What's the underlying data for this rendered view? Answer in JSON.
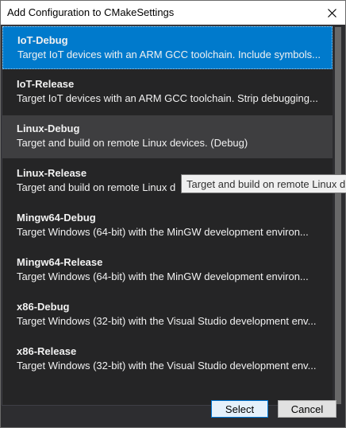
{
  "window": {
    "title": "Add Configuration to CMakeSettings"
  },
  "configurations": [
    {
      "name": "IoT-Debug",
      "description": "Target IoT devices with an ARM GCC toolchain. Include symbols..."
    },
    {
      "name": "IoT-Release",
      "description": "Target IoT devices with an ARM GCC toolchain. Strip debugging..."
    },
    {
      "name": "Linux-Debug",
      "description": "Target and build on remote Linux devices. (Debug)"
    },
    {
      "name": "Linux-Release",
      "description": "Target and build on remote Linux d"
    },
    {
      "name": "Mingw64-Debug",
      "description": "Target Windows (64-bit) with the MinGW development environ..."
    },
    {
      "name": "Mingw64-Release",
      "description": "Target Windows (64-bit) with the MinGW development environ..."
    },
    {
      "name": "x86-Debug",
      "description": "Target Windows (32-bit) with the Visual Studio development env..."
    },
    {
      "name": "x86-Release",
      "description": "Target Windows (32-bit) with the Visual Studio development env..."
    }
  ],
  "tooltip": {
    "text": "Target and build on remote Linux d"
  },
  "buttons": {
    "select": "Select",
    "cancel": "Cancel"
  },
  "colors": {
    "selected": "#007acc",
    "hover": "#3e3e40",
    "list_bg": "#252526",
    "dialog_bg": "#2d2d30"
  }
}
